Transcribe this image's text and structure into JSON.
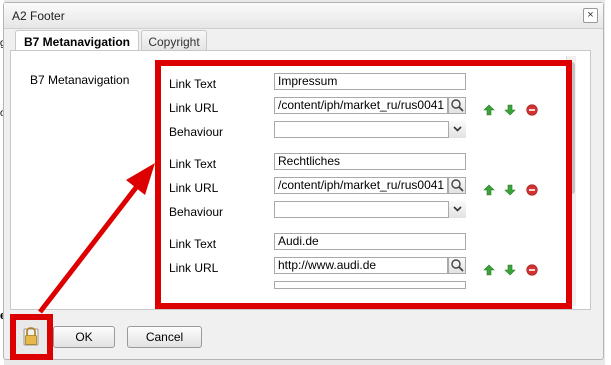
{
  "dialog": {
    "title": "A2 Footer",
    "close_icon": "×"
  },
  "tabs": [
    {
      "label": "B7 Metanavigation",
      "active": true
    },
    {
      "label": "Copyright",
      "active": false
    }
  ],
  "section_label": "B7 Metanavigation",
  "labels": {
    "link_text": "Link Text",
    "link_url": "Link URL",
    "behaviour": "Behaviour"
  },
  "items": [
    {
      "link_text": "Impressum",
      "link_url": "/content/iph/market_ru/rus0041",
      "behaviour": ""
    },
    {
      "link_text": "Rechtliches",
      "link_url": "/content/iph/market_ru/rus0041",
      "behaviour": ""
    },
    {
      "link_text": "Audi.de",
      "link_url": "http://www.audi.de",
      "behaviour": ""
    }
  ],
  "item_icons": [
    "arrow-up-icon",
    "arrow-down-icon",
    "remove-icon"
  ],
  "footer": {
    "ok_label": "OK",
    "cancel_label": "Cancel",
    "lock_icon": "lock-icon"
  },
  "colors": {
    "highlight": "#dd0000",
    "up_arrow": "#3aa33a",
    "down_arrow": "#3aa33a",
    "remove": "#d23232"
  },
  "background": {
    "edge_text_1": "g",
    "edge_text_2": "o",
    "edge_text_3": "e"
  }
}
